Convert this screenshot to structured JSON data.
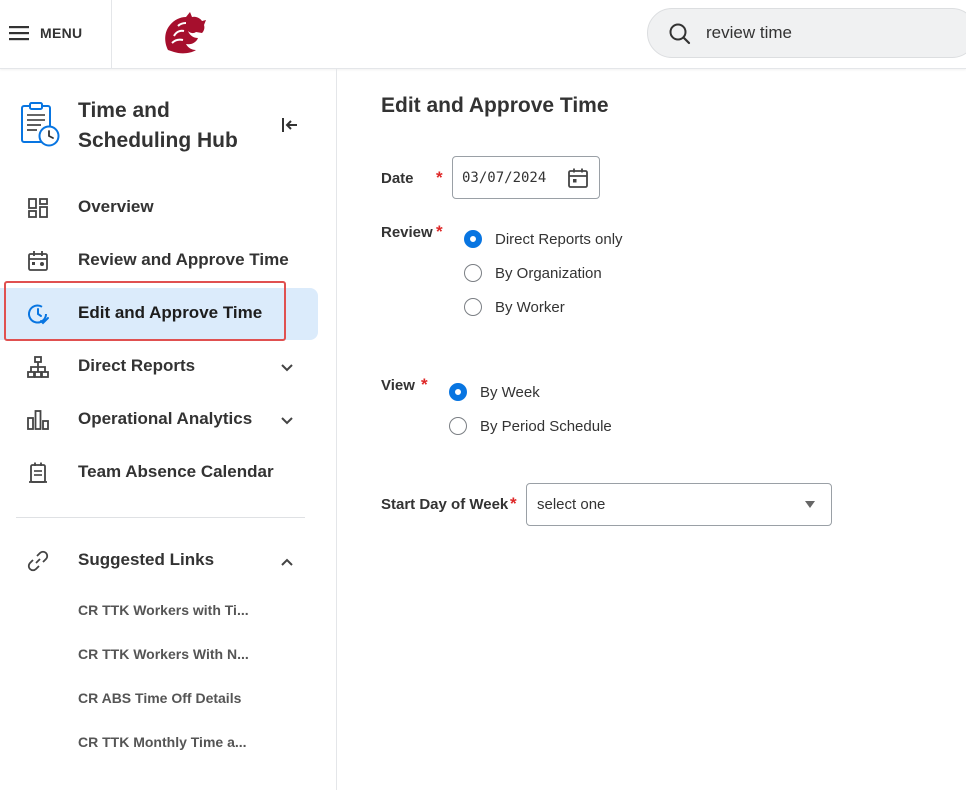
{
  "topbar": {
    "menu_label": "MENU",
    "search": {
      "value": "review time",
      "placeholder": "Search"
    }
  },
  "sidebar": {
    "hub_title": "Time and Scheduling Hub",
    "items": [
      {
        "label": "Overview",
        "icon": "dashboard-icon"
      },
      {
        "label": "Review and Approve Time",
        "icon": "calendar-person-icon"
      },
      {
        "label": "Edit and Approve Time",
        "icon": "clock-check-icon",
        "active": true
      },
      {
        "label": "Direct Reports",
        "icon": "org-chart-icon",
        "expandable": true
      },
      {
        "label": "Operational Analytics",
        "icon": "bar-chart-icon",
        "expandable": true
      },
      {
        "label": "Team Absence Calendar",
        "icon": "calendar-icon"
      }
    ],
    "suggested_links": {
      "label": "Suggested Links",
      "links": [
        "CR TTK Workers with Ti...",
        "CR TTK Workers With N...",
        "CR ABS Time Off Details",
        "CR TTK Monthly Time a..."
      ]
    }
  },
  "main": {
    "title": "Edit and Approve Time",
    "date": {
      "label": "Date",
      "value": "03/07/2024"
    },
    "review": {
      "label": "Review",
      "options": [
        "Direct Reports only",
        "By Organization",
        "By Worker"
      ],
      "selected": "Direct Reports only"
    },
    "view": {
      "label": "View",
      "options": [
        "By Week",
        "By Period Schedule"
      ],
      "selected": "By Week"
    },
    "start_day": {
      "label": "Start Day of Week",
      "value": "select one"
    },
    "required_marker": "*"
  },
  "colors": {
    "accent": "#0875e1",
    "active_nav_bg": "#dbebfb",
    "required": "#de2727",
    "highlight_border": "#e05050",
    "brand": "#a60f2d"
  }
}
